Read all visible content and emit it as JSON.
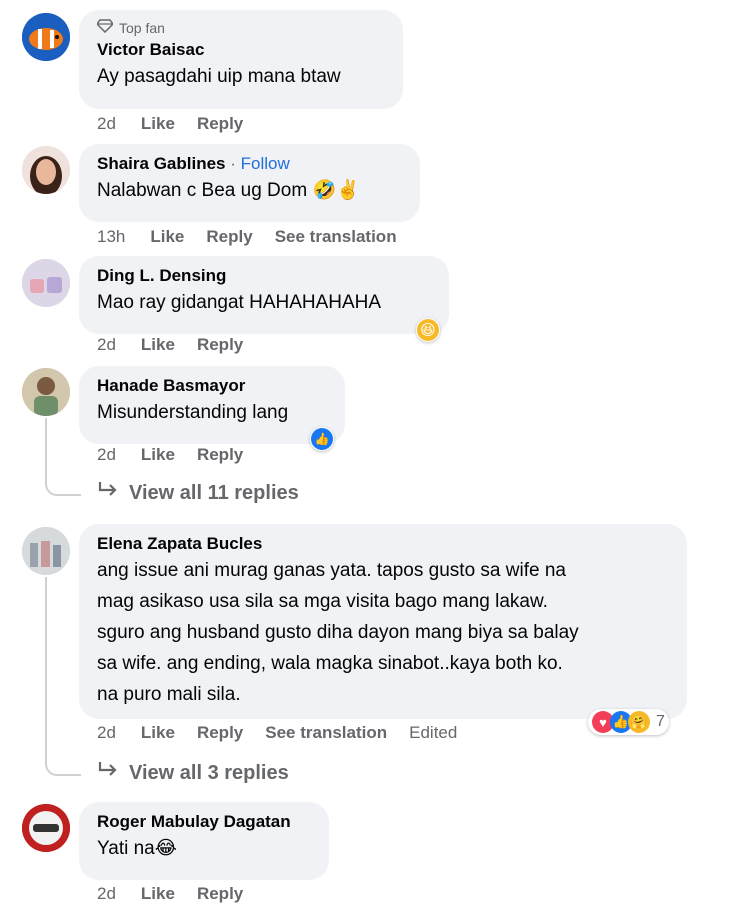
{
  "comments": [
    {
      "badge": "Top fan",
      "name": "Victor Baisac",
      "text": "Ay pasagdahi uip mana btaw",
      "time": "2d",
      "like": "Like",
      "reply": "Reply"
    },
    {
      "name": "Shaira Gablines",
      "separator": "·",
      "follow": "Follow",
      "text": "Nalabwan c Bea ug Dom 🤣✌️",
      "time": "13h",
      "like": "Like",
      "reply": "Reply",
      "translate": "See translation"
    },
    {
      "name": "Ding L. Densing",
      "text": "Mao ray gidangat HAHAHAHAHA",
      "time": "2d",
      "like": "Like",
      "reply": "Reply",
      "reaction": "😆"
    },
    {
      "name": "Hanade Basmayor",
      "text": "Misunderstanding lang",
      "time": "2d",
      "like": "Like",
      "reply": "Reply",
      "reaction": "👍",
      "view_replies": "View all 11 replies"
    },
    {
      "name": "Elena Zapata Bucles",
      "text_lines": [
        "ang issue ani murag ganas yata. tapos gusto sa wife na",
        "mag asikaso usa sila sa mga visita bago mang lakaw.",
        "sguro ang husband gusto diha dayon mang biya sa balay",
        "sa wife. ang ending, wala magka sinabot..kaya both ko.",
        "na puro mali sila."
      ],
      "time": "2d",
      "like": "Like",
      "reply": "Reply",
      "translate": "See translation",
      "edited": "Edited",
      "reaction_count": "7",
      "view_replies": "View all 3 replies"
    },
    {
      "name": "Roger Mabulay Dagatan",
      "text": "Yati na😂",
      "time": "2d",
      "like": "Like",
      "reply": "Reply"
    }
  ],
  "colors": {
    "bubble": "#f0f2f5",
    "meta": "#65676b",
    "follow": "#216fdb",
    "like_blue": "#1877f2",
    "love_red": "#f33e58"
  }
}
